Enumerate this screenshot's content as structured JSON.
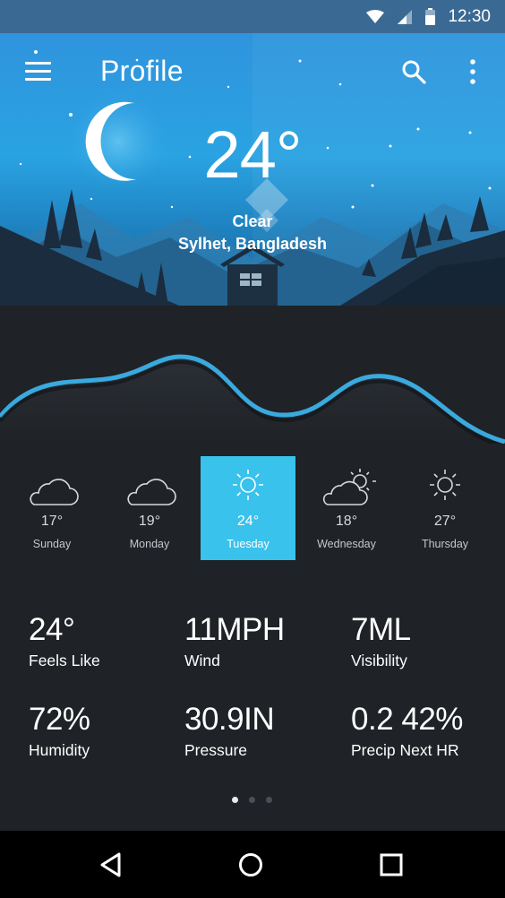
{
  "status_bar": {
    "time": "12:30",
    "icons": [
      "wifi-icon",
      "signal-icon",
      "battery-icon"
    ]
  },
  "app_bar": {
    "title": "Profile",
    "icons": [
      "menu-icon",
      "search-icon",
      "more-vert-icon"
    ]
  },
  "current": {
    "temperature": "24°",
    "condition": "Clear",
    "location": "Sylhet, Bangladesh"
  },
  "forecast": [
    {
      "temp": "17°",
      "day": "Sunday",
      "icon": "cloud-icon"
    },
    {
      "temp": "19°",
      "day": "Monday",
      "icon": "cloud-icon"
    },
    {
      "temp": "24°",
      "day": "Tuesday",
      "icon": "sun-icon",
      "selected": true
    },
    {
      "temp": "18°",
      "day": "Wednesday",
      "icon": "partly-cloudy-icon"
    },
    {
      "temp": "27°",
      "day": "Thursday",
      "icon": "sun-icon"
    }
  ],
  "details": [
    {
      "value": "24°",
      "label": "Feels Like"
    },
    {
      "value": "11MPH",
      "label": "Wind"
    },
    {
      "value": "7ML",
      "label": "Visibility"
    },
    {
      "value": "72%",
      "label": "Humidity"
    },
    {
      "value": "30.9IN",
      "label": "Pressure"
    },
    {
      "value": "0.2 42%",
      "label": "Precip Next HR"
    }
  ],
  "pager": {
    "pages": 3,
    "current": 1
  },
  "colors": {
    "accent": "#38c2ec",
    "background": "#1f2226",
    "sky": "#2a9fe0",
    "wave": "#3aa9de"
  }
}
